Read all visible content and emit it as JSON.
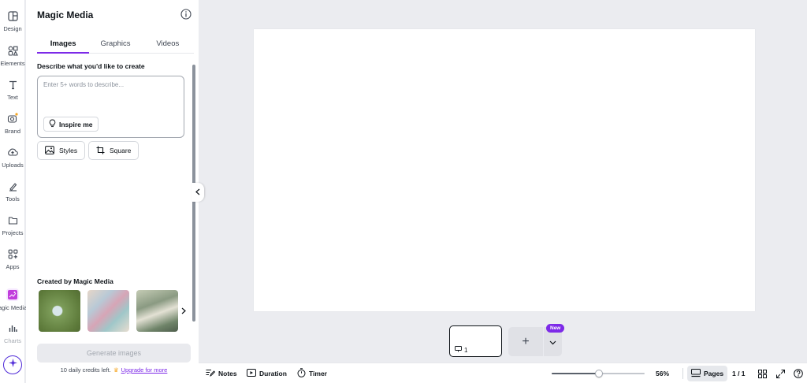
{
  "rail": {
    "items": [
      {
        "label": "Design",
        "icon": "design-icon"
      },
      {
        "label": "Elements",
        "icon": "elements-icon"
      },
      {
        "label": "Text",
        "icon": "text-icon"
      },
      {
        "label": "Brand",
        "icon": "brand-icon"
      },
      {
        "label": "Uploads",
        "icon": "uploads-icon"
      },
      {
        "label": "Tools",
        "icon": "tools-icon"
      },
      {
        "label": "Projects",
        "icon": "projects-icon"
      },
      {
        "label": "Apps",
        "icon": "apps-icon"
      },
      {
        "label": "Magic Media",
        "icon": "magic-media-icon"
      },
      {
        "label": "Charts",
        "icon": "charts-icon"
      }
    ]
  },
  "panel": {
    "title": "Magic Media",
    "tabs": [
      "Images",
      "Graphics",
      "Videos"
    ],
    "active_tab": "Images",
    "describe_label": "Describe what you'd like to create",
    "prompt": {
      "value": "",
      "placeholder": "Enter 5+ words to describe..."
    },
    "inspire_label": "Inspire me",
    "styles_label": "Styles",
    "square_label": "Square",
    "created_label": "Created by Magic Media",
    "generate_label": "Generate images",
    "credits_text": "10 daily credits left.",
    "upgrade_label": "Upgrade for more"
  },
  "pages": {
    "thumb_number": "1",
    "add_label": "+",
    "new_badge": "New"
  },
  "bottom_bar": {
    "notes_label": "Notes",
    "duration_label": "Duration",
    "timer_label": "Timer",
    "zoom_percent": 56,
    "zoom_label": "56%",
    "pages_label": "Pages",
    "page_count": "1 / 1"
  },
  "colors": {
    "accent": "#7d2ae8",
    "magic_button": "#4f2ad8"
  }
}
